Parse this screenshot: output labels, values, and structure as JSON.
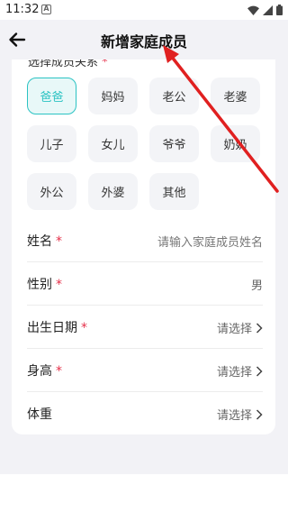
{
  "status_bar": {
    "time": "11:32",
    "notification_badge": "A",
    "icons": [
      "wifi-icon",
      "signal-icon",
      "battery-icon"
    ]
  },
  "header": {
    "title": "新增家庭成员",
    "back_icon": "arrow-left-icon"
  },
  "relation": {
    "label": "选择成员关系",
    "required_mark": "*",
    "options": [
      "爸爸",
      "妈妈",
      "老公",
      "老婆",
      "儿子",
      "女儿",
      "爷爷",
      "奶奶",
      "外公",
      "外婆",
      "其他"
    ],
    "selected": "爸爸"
  },
  "form": {
    "name": {
      "label": "姓名",
      "required_mark": "*",
      "placeholder": "请输入家庭成员姓名"
    },
    "gender": {
      "label": "性别",
      "required_mark": "*",
      "value": "男"
    },
    "birthday": {
      "label": "出生日期",
      "required_mark": "*",
      "value": "请选择"
    },
    "height": {
      "label": "身高",
      "required_mark": "*",
      "value": "请选择"
    },
    "weight": {
      "label": "体重",
      "value": "请选择"
    }
  },
  "colors": {
    "accent": "#2bc3c3",
    "required": "#e5304a",
    "page_bg": "#f2f2f6",
    "annotation_arrow": "#e02020"
  }
}
